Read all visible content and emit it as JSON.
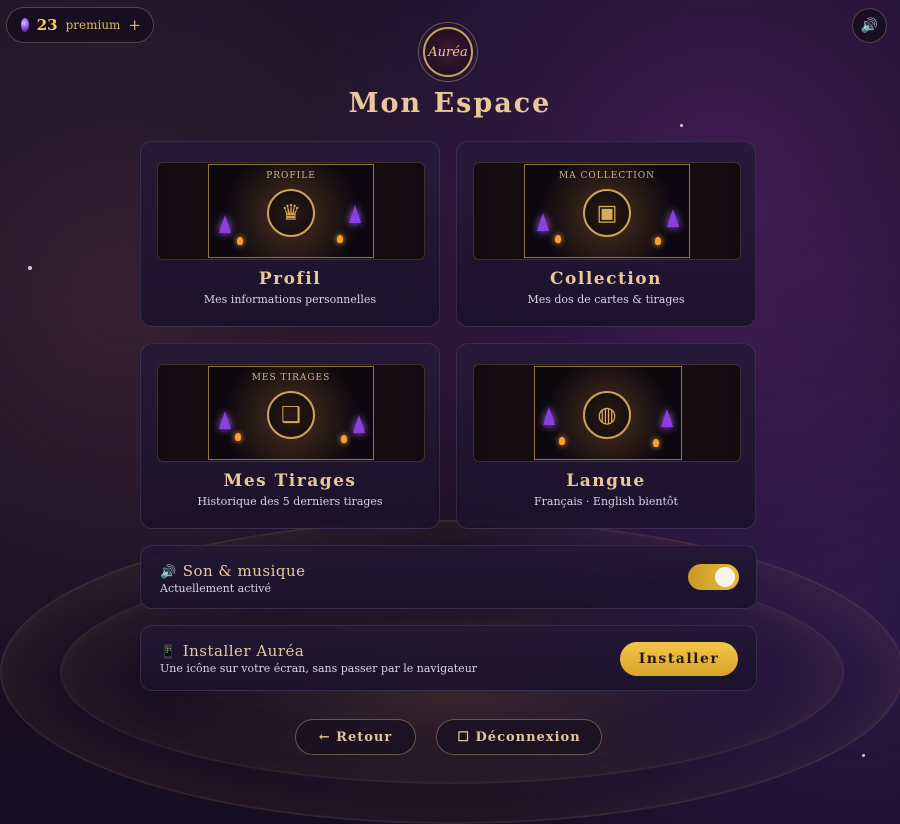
{
  "colors": {
    "gold": "#e9c89a",
    "accent": "#e7bc3c",
    "credit": "#f1cd63"
  },
  "credits": {
    "count": "23",
    "label": "premium",
    "plus": "+",
    "icon": "gem-icon"
  },
  "sound_toggle_icon": "🔊",
  "logo": {
    "text": "Auréa"
  },
  "page_title": "Mon Espace",
  "cards": [
    {
      "banner": "PROFILE",
      "title": "Profil",
      "desc": "Mes informations personnelles",
      "icon": "bust-icon",
      "glyph": "♛"
    },
    {
      "banner": "MA COLLECTION",
      "title": "Collection",
      "desc": "Mes dos de cartes & tirages",
      "icon": "chest-icon",
      "glyph": "▣"
    },
    {
      "banner": "MES TIRAGES",
      "title": "Mes Tirages",
      "desc": "Historique des 5 derniers tirages",
      "icon": "book-icon",
      "glyph": "❑"
    },
    {
      "banner": "",
      "title": "Langue",
      "desc": "Français · English bientôt",
      "icon": "globe-icon",
      "glyph": "◍"
    }
  ],
  "sound": {
    "icon": "🔊",
    "title": "Son & musique",
    "status": "Actuellement activé",
    "enabled": true
  },
  "install": {
    "icon": "📱",
    "title": "Installer Auréa",
    "desc": "Une icône sur votre écran, sans passer par le navigateur",
    "button": "Installer"
  },
  "nav": {
    "back": "← Retour",
    "logout": "☐ Déconnexion"
  }
}
